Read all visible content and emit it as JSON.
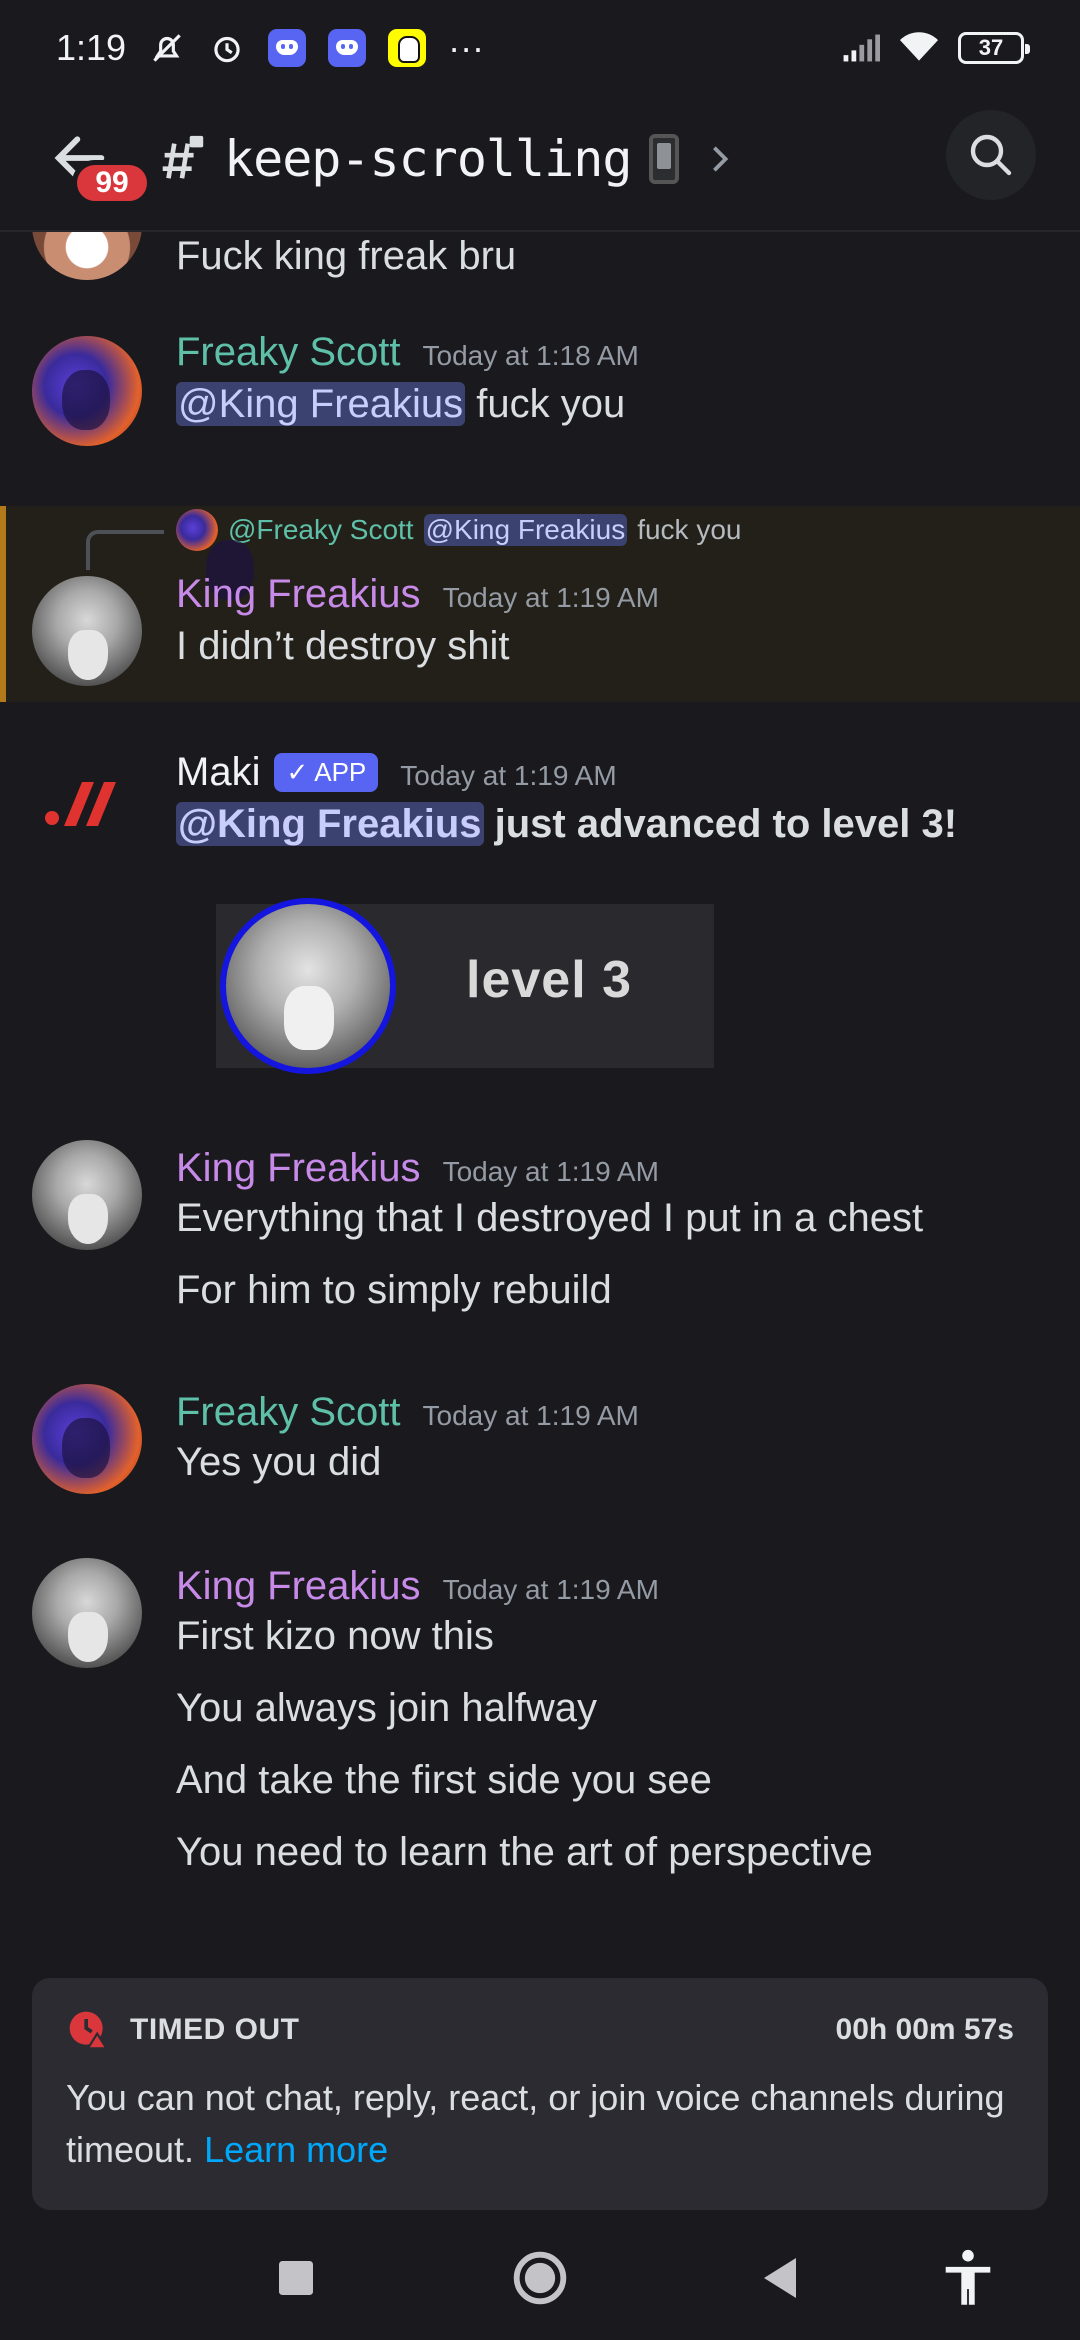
{
  "status_bar": {
    "time": "1:19",
    "more": "···",
    "battery": "37"
  },
  "header": {
    "badge_count": "99",
    "channel_name": "keep-scrolling"
  },
  "messages": [
    {
      "text": "Fuck king freak bru"
    },
    {
      "author": "Freaky Scott",
      "time": "Today at 1:18 AM",
      "mention": "@King Freakius",
      "text": " fuck you"
    },
    {
      "reply_to_author": "@Freaky Scott",
      "reply_mention": "@King Freakius",
      "reply_text": "fuck you",
      "author": "King Freakius",
      "time": "Today at 1:19 AM",
      "text": "I didn’t destroy shit"
    },
    {
      "author": "Maki",
      "app_tag": "APP",
      "time": "Today at 1:19 AM",
      "mention": "@King Freakius",
      "text": " just advanced to level 3!",
      "card_text": "level 3"
    },
    {
      "author": "King Freakius",
      "time": "Today at 1:19 AM",
      "lines": [
        "Everything that I destroyed I put in a chest",
        "For him to simply rebuild"
      ]
    },
    {
      "author": "Freaky Scott",
      "time": "Today at 1:19 AM",
      "text": "Yes you did"
    },
    {
      "author": "King Freakius",
      "time": "Today at 1:19 AM",
      "lines": [
        "First kizo now this",
        "You always join halfway",
        "And take the first side you see",
        "You need to learn the art of perspective"
      ]
    }
  ],
  "timeout": {
    "title": "TIMED OUT",
    "timer": "00h 00m 57s",
    "message": "You can not chat, reply, react, or join voice channels during timeout.",
    "link": "Learn more"
  },
  "colors": {
    "background": "#1a1a1e",
    "scott_name": "#5fc0a9",
    "king_name": "#c78ae8",
    "mention_bg": "#3c4270",
    "link": "#00a8fc",
    "danger": "#da373c"
  }
}
